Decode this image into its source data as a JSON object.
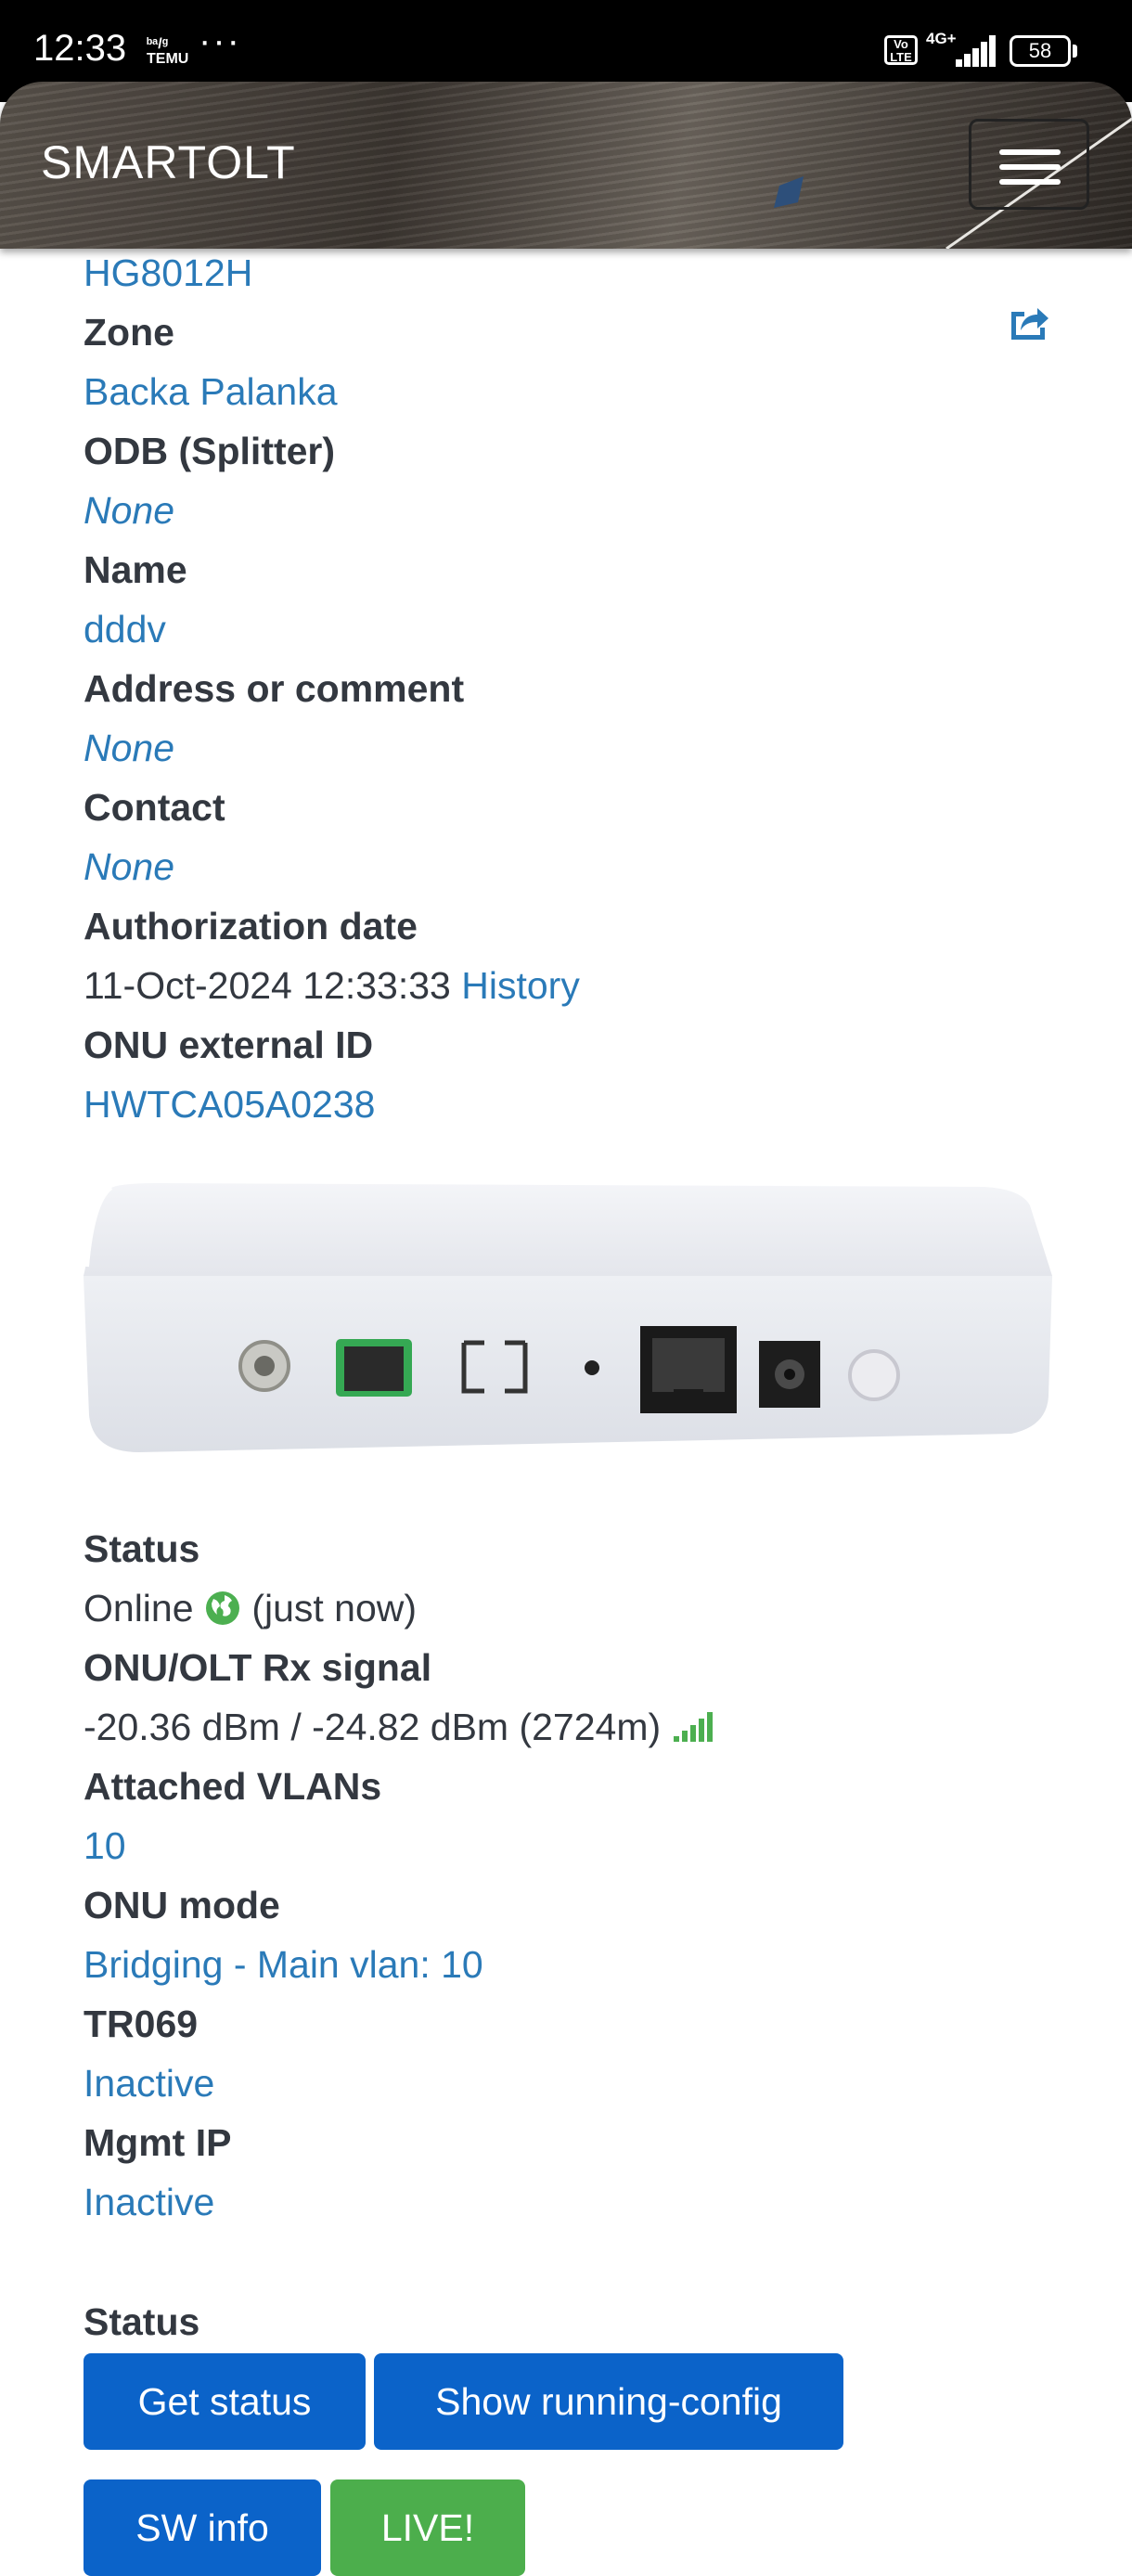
{
  "status_bar": {
    "time": "12:33",
    "carrier_line1": "ᵇᵃ/ᵍ",
    "carrier_line2": "TEMU",
    "more": "···",
    "volte": "Vo LTE",
    "network": "4G+",
    "battery": "58"
  },
  "navbar": {
    "brand": "SMARTOLT",
    "menu_icon": "hamburger-menu-icon"
  },
  "details": [
    {
      "key": "onu_type",
      "label": "",
      "value": "HG8012H",
      "style": "link"
    },
    {
      "key": "zone",
      "label": "Zone",
      "value": "Backa Palanka",
      "style": "link"
    },
    {
      "key": "odb",
      "label": "ODB (Splitter)",
      "value": "None",
      "style": "link-italic"
    },
    {
      "key": "name",
      "label": "Name",
      "value": "dddv",
      "style": "link"
    },
    {
      "key": "address",
      "label": "Address or comment",
      "value": "None",
      "style": "link-italic"
    },
    {
      "key": "contact",
      "label": "Contact",
      "value": "None",
      "style": "link-italic"
    },
    {
      "key": "auth_date",
      "label": "Authorization date",
      "value": "11-Oct-2024 12:33:33",
      "extra_link": "History",
      "style": "plain"
    },
    {
      "key": "external_id",
      "label": "ONU external ID",
      "value": "HWTCA05A0238",
      "style": "link"
    }
  ],
  "status_section": {
    "status_label": "Status",
    "status_value": "Online",
    "status_icon": "globe-icon",
    "status_time": "(just now)",
    "signal_label": "ONU/OLT Rx signal",
    "signal_value": "-20.36 dBm / -24.82 dBm (2724m)",
    "signal_icon": "signal-bars-icon",
    "vlans_label": "Attached VLANs",
    "vlans_value": "10",
    "mode_label": "ONU mode",
    "mode_value": "Bridging - Main vlan: 10",
    "tr069_label": "TR069",
    "tr069_value": "Inactive",
    "mgmt_label": "Mgmt IP",
    "mgmt_value": "Inactive"
  },
  "actions": {
    "section_label": "Status",
    "get_status": "Get status",
    "show_running_config": "Show running-config",
    "sw_info": "SW info",
    "live": "LIVE!"
  },
  "colors": {
    "link": "#2a7ab8",
    "label": "#333840",
    "button_blue": "#0b63c9",
    "button_green": "#4cae4c",
    "online_green": "#4caf50"
  }
}
